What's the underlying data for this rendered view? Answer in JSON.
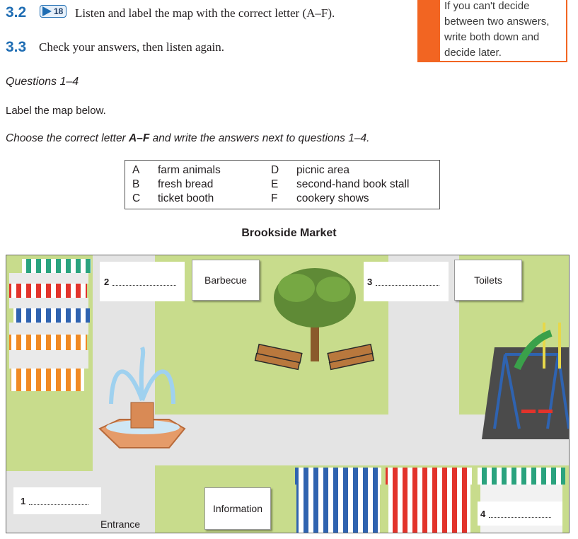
{
  "exercise_32": {
    "number": "3.2",
    "track": "18",
    "instruction": "Listen and label the map with the correct letter (A–F)."
  },
  "exercise_33": {
    "number": "3.3",
    "instruction": "Check your answers, then listen again."
  },
  "tip": {
    "lines": [
      "If you can't decide",
      "between two answers,",
      "write both down and",
      "decide later."
    ]
  },
  "questions_heading": "Questions 1–4",
  "instruction_label": "Label the map below.",
  "instruction_choose": {
    "part1": "Choose the correct letter ",
    "bold": "A–F",
    "part2": " and write the answers next to questions 1–4."
  },
  "options": [
    {
      "letter": "A",
      "text": "farm animals"
    },
    {
      "letter": "B",
      "text": "fresh bread"
    },
    {
      "letter": "C",
      "text": "ticket booth"
    },
    {
      "letter": "D",
      "text": "picnic area"
    },
    {
      "letter": "E",
      "text": "second-hand book stall"
    },
    {
      "letter": "F",
      "text": "cookery shows"
    }
  ],
  "map": {
    "title": "Brookside Market",
    "labels": {
      "barbecue": "Barbecue",
      "toilets": "Toilets",
      "information": "Information",
      "entrance": "Entrance"
    },
    "questions": {
      "q1": "1",
      "q2": "2",
      "q3": "3",
      "q4": "4"
    }
  },
  "colors": {
    "accent_blue": "#1f6db3",
    "tip_orange": "#f26522",
    "grass": "#c8dc8c",
    "path": "#e4e4e4"
  }
}
